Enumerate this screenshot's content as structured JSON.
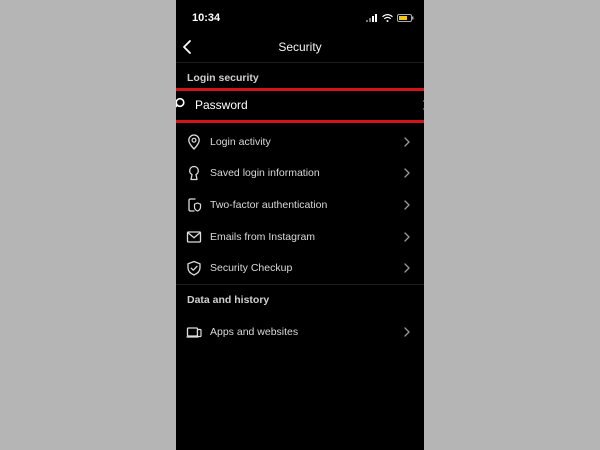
{
  "status_bar": {
    "time": "10:34"
  },
  "header": {
    "title": "Security"
  },
  "sections": {
    "login_security": {
      "title": "Login security",
      "items": [
        {
          "label": "Password",
          "icon": "key-icon"
        },
        {
          "label": "Login activity",
          "icon": "location-pin-icon"
        },
        {
          "label": "Saved login information",
          "icon": "keyhole-icon"
        },
        {
          "label": "Two-factor authentication",
          "icon": "phone-shield-icon"
        },
        {
          "label": "Emails from Instagram",
          "icon": "mail-icon"
        },
        {
          "label": "Security Checkup",
          "icon": "shield-check-icon"
        }
      ]
    },
    "data_history": {
      "title": "Data and history",
      "items": [
        {
          "label": "Apps and websites",
          "icon": "devices-icon"
        }
      ]
    }
  },
  "colors": {
    "highlight_border": "#d3141b",
    "background": "#000000",
    "page_bg": "#b5b5b5"
  }
}
